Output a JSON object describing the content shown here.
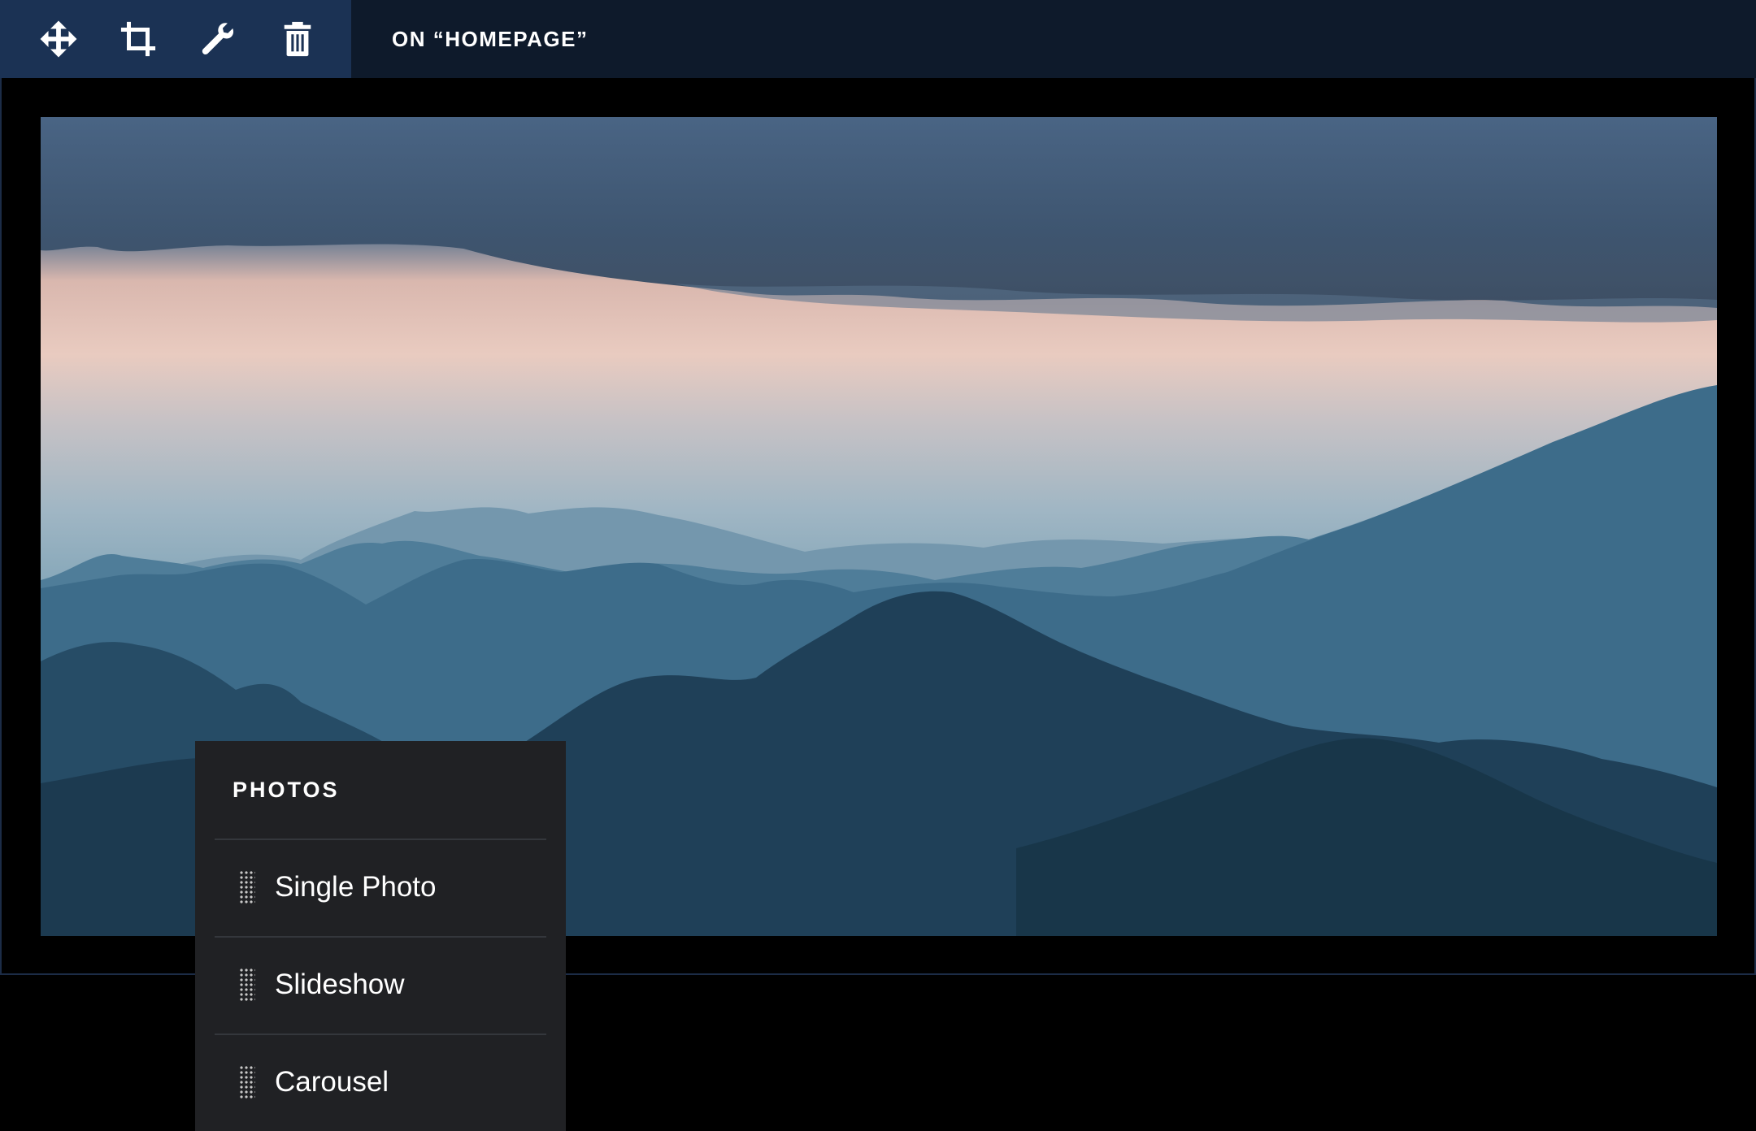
{
  "toolbar": {
    "tools": [
      {
        "name": "move",
        "icon": "move-icon"
      },
      {
        "name": "crop",
        "icon": "crop-icon"
      },
      {
        "name": "settings",
        "icon": "wrench-icon"
      },
      {
        "name": "delete",
        "icon": "trash-icon"
      }
    ],
    "title": "ON “HOMEPAGE”"
  },
  "photo": {
    "subject": "mountain-landscape-image"
  },
  "panel": {
    "title": "PHOTOS",
    "items": [
      {
        "label": "Single Photo"
      },
      {
        "label": "Slideshow"
      },
      {
        "label": "Carousel"
      }
    ]
  },
  "colors": {
    "toolbar_bg": "#0e1a2b",
    "tool_group_bg": "#1b3254",
    "panel_bg": "#202124",
    "frame_border": "#1c2c47"
  }
}
